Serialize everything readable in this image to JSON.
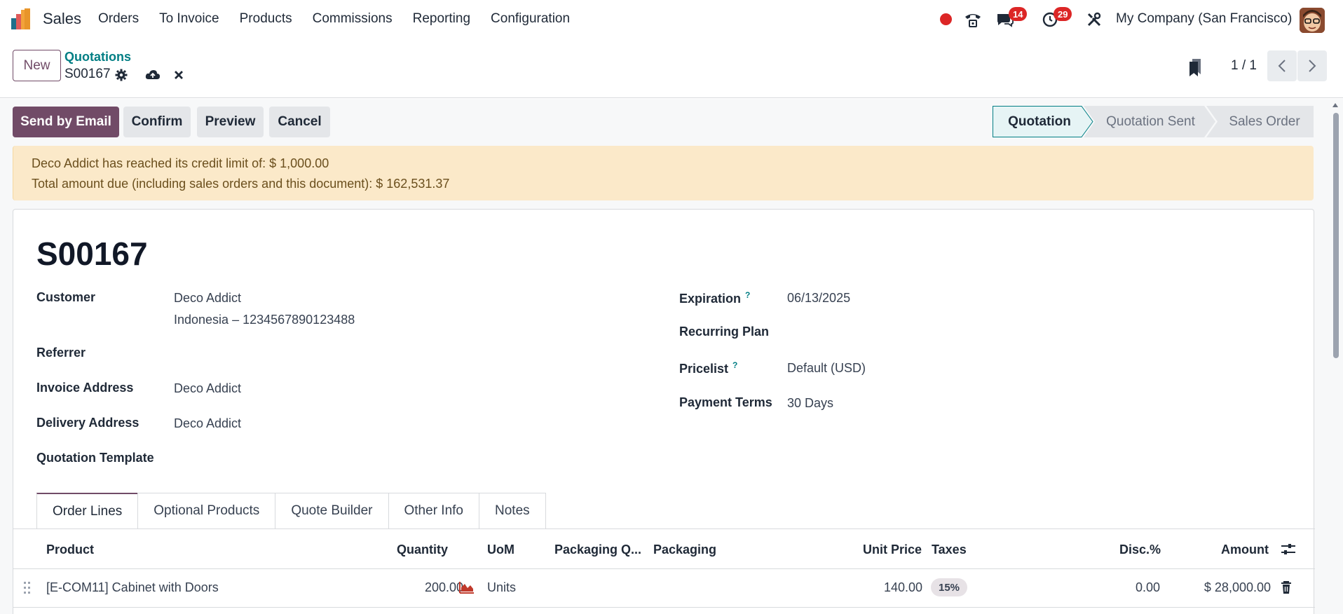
{
  "app": {
    "name": "Sales",
    "menu": [
      "Orders",
      "To Invoice",
      "Products",
      "Commissions",
      "Reporting",
      "Configuration"
    ],
    "messages_badge": "14",
    "activities_badge": "29",
    "company": "My Company (San Francisco)"
  },
  "control": {
    "new_label": "New",
    "breadcrumb_parent": "Quotations",
    "breadcrumb_current": "S00167",
    "pager": "1 / 1"
  },
  "statusbar": {
    "buttons": [
      "Send by Email",
      "Confirm",
      "Preview",
      "Cancel"
    ],
    "stages": [
      "Quotation",
      "Quotation Sent",
      "Sales Order"
    ],
    "active_stage": "Quotation"
  },
  "alert": {
    "line1": "Deco Addict has reached its credit limit of: $ 1,000.00",
    "line2": "Total amount due (including sales orders and this document): $ 162,531.37"
  },
  "form": {
    "title": "S00167",
    "left": {
      "customer_label": "Customer",
      "customer_name": "Deco Addict",
      "customer_detail": "Indonesia – 1234567890123488",
      "referrer_label": "Referrer",
      "invoice_address_label": "Invoice Address",
      "invoice_address": "Deco Addict",
      "delivery_address_label": "Delivery Address",
      "delivery_address": "Deco Addict",
      "quotation_template_label": "Quotation Template"
    },
    "right": {
      "expiration_label": "Expiration",
      "expiration": "06/13/2025",
      "recurring_plan_label": "Recurring Plan",
      "pricelist_label": "Pricelist",
      "pricelist": "Default (USD)",
      "payment_terms_label": "Payment Terms",
      "payment_terms": "30 Days",
      "help_mark": "?"
    }
  },
  "tabs": [
    "Order Lines",
    "Optional Products",
    "Quote Builder",
    "Other Info",
    "Notes"
  ],
  "table": {
    "headers": {
      "product": "Product",
      "quantity": "Quantity",
      "uom": "UoM",
      "packaging_qty": "Packaging Q...",
      "packaging": "Packaging",
      "unit_price": "Unit Price",
      "taxes": "Taxes",
      "discount": "Disc.%",
      "amount": "Amount"
    },
    "rows": [
      {
        "product": "[E-COM11] Cabinet with Doors",
        "quantity": "200.00",
        "uom": "Units",
        "unit_price": "140.00",
        "taxes": "15%",
        "discount": "0.00",
        "amount": "$ 28,000.00"
      }
    ]
  },
  "colors": {
    "primary": "#714b67",
    "link": "#017e84",
    "alert_bg": "#fbe9c9",
    "badge": "#dc2626",
    "active_stage_bg": "#e6f4f5"
  }
}
